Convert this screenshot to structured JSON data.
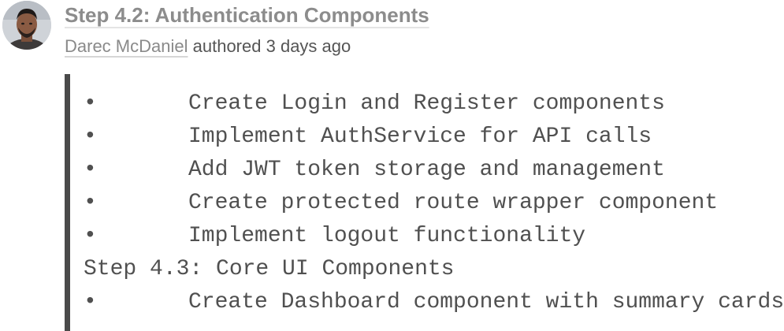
{
  "commit": {
    "title": "Step 4.2: Authentication Components",
    "author": "Darec McDaniel",
    "action": "authored",
    "time": "3 days ago"
  },
  "message": {
    "lines": [
      {
        "type": "bullet",
        "text": "Create Login and Register components"
      },
      {
        "type": "bullet",
        "text": "Implement AuthService for API calls"
      },
      {
        "type": "bullet",
        "text": "Add JWT token storage and management"
      },
      {
        "type": "bullet",
        "text": "Create protected route wrapper component"
      },
      {
        "type": "bullet",
        "text": "Implement logout functionality"
      },
      {
        "type": "heading",
        "text": "Step 4.3: Core UI Components"
      },
      {
        "type": "bullet",
        "text": "Create Dashboard component with summary cards"
      }
    ],
    "bullet_char": "•"
  },
  "colors": {
    "quote_bar": "#4a4a4a",
    "title": "#8c8c8c",
    "text": "#505050"
  }
}
